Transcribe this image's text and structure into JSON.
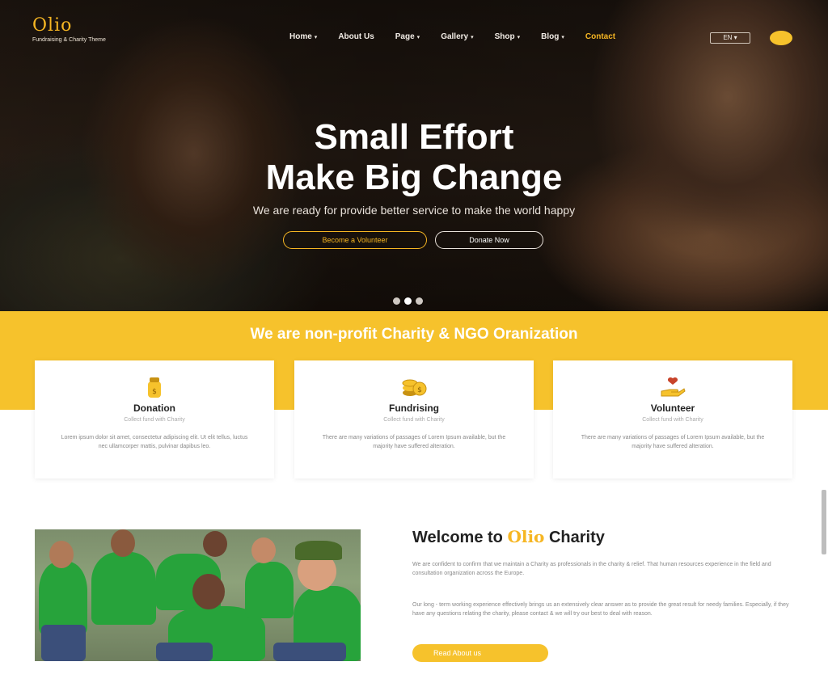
{
  "header": {
    "logo_text": "Olio",
    "logo_tagline": "Fundraising & Charity Theme",
    "nav": [
      {
        "label": "Home",
        "has_caret": true
      },
      {
        "label": "About Us",
        "has_caret": false
      },
      {
        "label": "Page",
        "has_caret": true
      },
      {
        "label": "Gallery",
        "has_caret": true
      },
      {
        "label": "Shop",
        "has_caret": true
      },
      {
        "label": "Blog",
        "has_caret": true
      },
      {
        "label": "Contact",
        "has_caret": false,
        "active": true
      }
    ],
    "language": "EN ▾"
  },
  "hero": {
    "title_line1": "Small Effort",
    "title_line2": "Make Big Change",
    "subtitle": "We are ready for provide better service to make the world happy",
    "btn_volunteer": "Become a Volunteer",
    "btn_donate": "Donate Now",
    "slides": 3,
    "active_slide": 2
  },
  "band": {
    "title": "We are non-profit Charity & NGO Oranization"
  },
  "cards": [
    {
      "icon": "donation-jar-icon",
      "title": "Donation",
      "tagline": "Collect fund with Charity",
      "text": "Lorem ipsum dolor sit amet, consectetur adipiscing elit. Ut elit tellus, luctus nec ullamcorper mattis, pulvinar dapibus leo."
    },
    {
      "icon": "fundraising-coins-icon",
      "title": "Fundrising",
      "tagline": "Collect fund with Charity",
      "text": "There are many variations of passages of Lorem Ipsum available, but the majority have suffered alteration."
    },
    {
      "icon": "volunteer-hand-icon",
      "title": "Volunteer",
      "tagline": "Collect fund with Charity",
      "text": "There are many variations of passages of Lorem Ipsum available, but the majority have suffered alteration."
    }
  ],
  "welcome": {
    "title_pre": "Welcome to",
    "title_brand": "Olio",
    "title_post": "Charity",
    "p1": "We are confident to confirm that we maintain a Charity as professionals in the charity & relief. That human resources experience in the field and consultation organization across the Europe.",
    "p2": "Our long - term working experience effectively brings us an extensively clear answer as to provide the great result for needy families. Especially, if they have any questions relating the charity, please contact & we will try our best to deal with reason.",
    "button": "Read About us"
  }
}
